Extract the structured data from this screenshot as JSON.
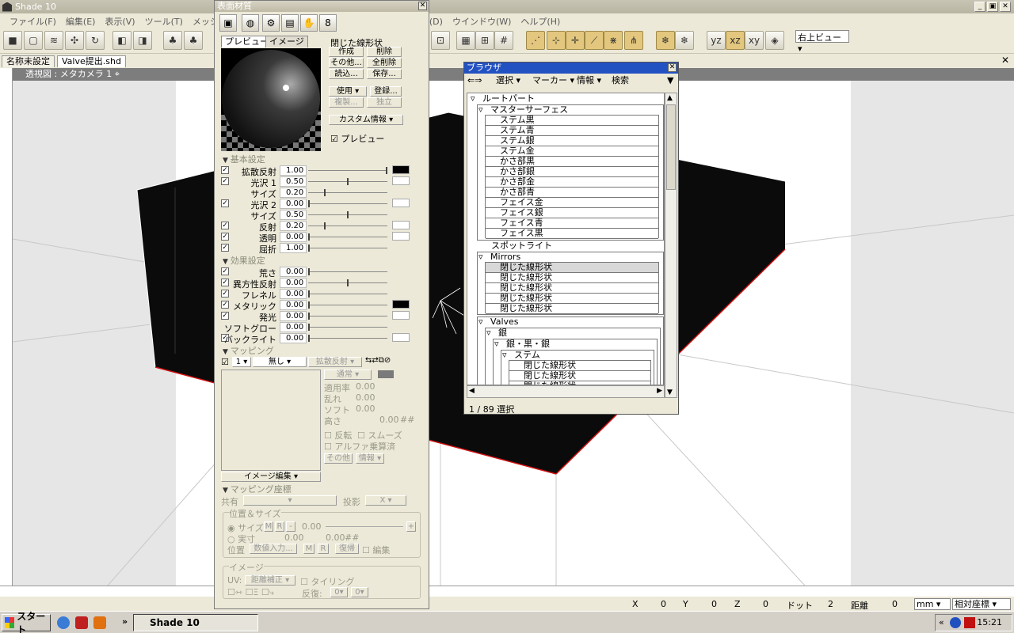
{
  "window": {
    "title": "Shade 10",
    "min": "_",
    "restore": "▣",
    "close": "✕"
  },
  "menu": [
    "ファイル(F)",
    "編集(E)",
    "表示(V)",
    "ツール(T)",
    "メッシュ",
    "ル(D)",
    "ウインドウ(W)",
    "ヘルプ(H)"
  ],
  "toolbar": {
    "view_select": "右上ビュー"
  },
  "doc_tabs": [
    "名称未設定",
    "Valve提出.shd"
  ],
  "doc_close": "✕",
  "viewport": {
    "label": "透視図 : メタカメラ 1"
  },
  "status": {
    "x_label": "X",
    "x_val": "0",
    "y_label": "Y",
    "y_val": "0",
    "z_label": "Z",
    "z_val": "0",
    "dot_label": "ドット",
    "dot_val": "2",
    "dist_label": "距離",
    "dist_val": "0",
    "unit": "mm",
    "coord_mode": "相対座標"
  },
  "taskbar": {
    "start": "スタート",
    "app": "Shade 10",
    "time": "15:21",
    "chevron": "«",
    "quick_more": "»"
  },
  "material": {
    "title": "表面材質",
    "tabs": [
      "プレビュー",
      "イメージ"
    ],
    "name": "閉じた線形状",
    "buttons": {
      "create": "作成",
      "delete": "削除",
      "other": "その他...",
      "delete_all": "全削除",
      "load": "読込...",
      "save": "保存...",
      "use": "使用",
      "register": "登録...",
      "duplicate": "複製...",
      "independent": "独立",
      "custom_info": "カスタム情報"
    },
    "preview_check": "プレビュー",
    "section_basic": "基本設定",
    "basic": [
      {
        "label": "拡散反射",
        "value": "1.00",
        "pos": 1.0,
        "checked": true,
        "swatch": "#000000"
      },
      {
        "label": "光沢 1",
        "value": "0.50",
        "pos": 0.5,
        "checked": true,
        "swatch": "#ffffff"
      },
      {
        "label": "サイズ",
        "value": "0.20",
        "pos": 0.2,
        "checked": false,
        "swatch": ""
      },
      {
        "label": "光沢 2",
        "value": "0.00",
        "pos": 0.0,
        "checked": true,
        "swatch": "#ffffff"
      },
      {
        "label": "サイズ",
        "value": "0.50",
        "pos": 0.5,
        "checked": false,
        "swatch": ""
      },
      {
        "label": "反射",
        "value": "0.20",
        "pos": 0.2,
        "checked": true,
        "swatch": "#ffffff"
      },
      {
        "label": "透明",
        "value": "0.00",
        "pos": 0.0,
        "checked": true,
        "swatch": "#ffffff"
      },
      {
        "label": "屈折",
        "value": "1.00",
        "pos": 0.0,
        "checked": true,
        "swatch": ""
      }
    ],
    "section_effect": "効果設定",
    "effect": [
      {
        "label": "荒さ",
        "value": "0.00",
        "pos": 0.0,
        "checked": true,
        "swatch": ""
      },
      {
        "label": "異方性反射",
        "value": "0.00",
        "pos": 0.5,
        "checked": true,
        "swatch": ""
      },
      {
        "label": "フレネル",
        "value": "0.00",
        "pos": 0.0,
        "checked": true,
        "swatch": ""
      },
      {
        "label": "メタリック",
        "value": "0.00",
        "pos": 0.0,
        "checked": true,
        "swatch": "#000000"
      },
      {
        "label": "発光",
        "value": "0.00",
        "pos": 0.0,
        "checked": true,
        "swatch": "#ffffff"
      },
      {
        "label": "ソフトグロー",
        "value": "0.00",
        "pos": 0.0,
        "checked": false,
        "swatch": ""
      },
      {
        "label": "バックライト",
        "value": "0.00",
        "pos": 0.0,
        "checked": true,
        "swatch": "#ffffff"
      }
    ],
    "section_mapping": "マッピング",
    "mapping": {
      "index": "1",
      "type": "無し",
      "channel": "拡散反射",
      "blend": "通常",
      "rate_label": "適用率",
      "rate": "0.00",
      "noise_label": "乱れ",
      "noise": "0.00",
      "soft_label": "ソフト",
      "soft": "0.00",
      "height_label": "高さ",
      "height": "0.00",
      "height_unit": "##",
      "invert": "反転",
      "smooth": "スムーズ",
      "alpha": "アルファ乗算済",
      "other": "その他",
      "info": "情報",
      "image_edit": "イメージ編集"
    },
    "section_coord": "マッピング座標",
    "coord": {
      "share_label": "共有",
      "proj_label": "投影",
      "proj": "X",
      "pos_size_label": "位置＆サイズ",
      "size_label": "サイズ",
      "m": "M",
      "r": "R",
      "minus": "-",
      "size_val": "0.00",
      "plus": "+",
      "real_label": "実寸",
      "real_a": "0.00",
      "real_b": "0.00",
      "real_unit": "##",
      "pos_label": "位置",
      "num_input": "数値入力...",
      "restore": "復帰",
      "edit": "編集"
    },
    "image_group": {
      "title": "イメージ",
      "uv_label": "UV:",
      "uv": "距離補正",
      "tiling": "タイリング",
      "repeat_label": "反復:",
      "repeat_a": "0",
      "repeat_b": "0"
    }
  },
  "browser": {
    "title": "ブラウザ",
    "menus": [
      "選択",
      "マーカー",
      "情報",
      "検索"
    ],
    "status": "1 / 89 選択",
    "root": "ルートパート",
    "group1": "マスターサーフェス",
    "group1_items": [
      "ステム黒",
      "ステム青",
      "ステム銀",
      "ステム金",
      "かさ部黒",
      "かさ部銀",
      "かさ部金",
      "かさ部青",
      "フェイス金",
      "フェイス銀",
      "フェイス青",
      "フェイス黒"
    ],
    "spotlight": "スポットライト",
    "group2": "Mirrors",
    "group2_items": [
      "閉じた線形状",
      "閉じた線形状",
      "閉じた線形状",
      "閉じた線形状",
      "閉じた線形状"
    ],
    "group3": "Valves",
    "sub1": "銀",
    "sub2": "銀・黒・銀",
    "sub3": "ステム",
    "sub3_items": [
      "閉じた線形状",
      "閉じた線形状",
      "閉じた線形状"
    ]
  },
  "colors": {
    "title_active": "#2251c2",
    "cube": "#0b0b0b",
    "edge_red": "#d01010",
    "grid": "#c8c8c8"
  }
}
